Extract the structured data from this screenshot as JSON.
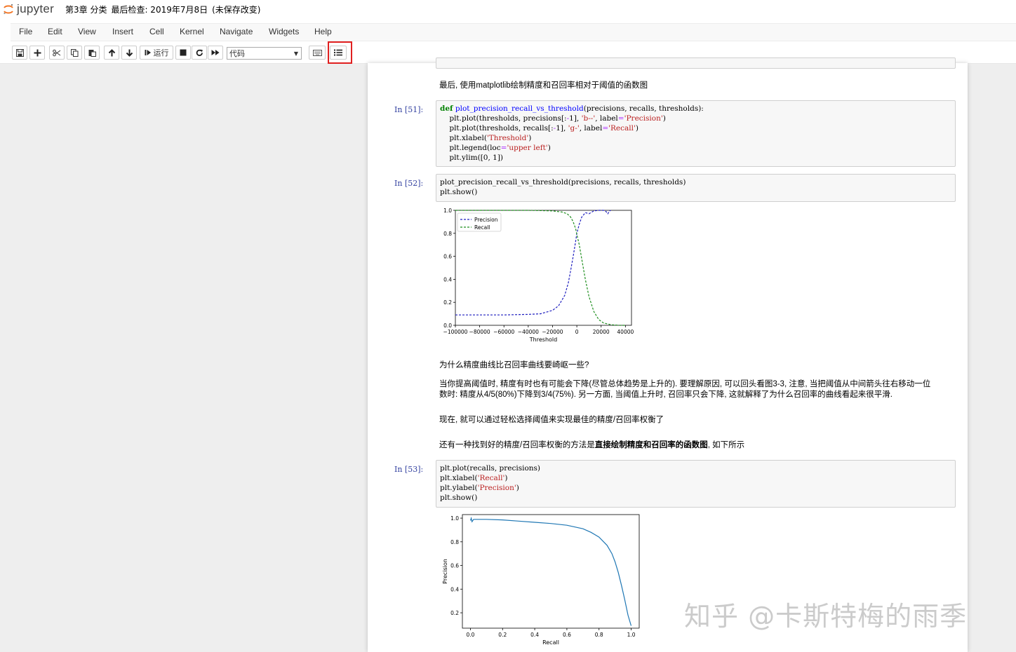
{
  "header": {
    "logo_text": "jupyter",
    "notebook_name": "第3章 分类",
    "checkpoint": "最后检查: 2019年7月8日",
    "save_status": "(未保存改变)"
  },
  "menu": [
    "File",
    "Edit",
    "View",
    "Insert",
    "Cell",
    "Kernel",
    "Navigate",
    "Widgets",
    "Help"
  ],
  "toolbar": {
    "run_label": "运行",
    "cell_type": "代码"
  },
  "cells": {
    "md_1": "最后, 使用matplotlib绘制精度和召回率相对于阈值的函数图",
    "c51_prompt": "In  [51]:",
    "c52_prompt": "In  [52]:",
    "c52_code": "plot_precision_recall_vs_threshold(precisions, recalls, thresholds)\nplt.show()",
    "md_2": "为什么精度曲线比召回率曲线要崎岖一些?",
    "md_3a": "当你提高阈值时, 精度有时也有可能会下降(尽管总体趋势是上升的). 要理解原因, 可以回头看图3-3, 注意, 当把阈值从中间箭头往右移动一位",
    "md_3b": "数时: 精度从4/5(80%)下降到3/4(75%). 另一方面, 当阈值上升时, 召回率只会下降, 这就解释了为什么召回率的曲线看起来很平滑.",
    "md_4": "现在, 就可以通过轻松选择阈值来实现最佳的精度/召回率权衡了",
    "md_5_pre": "还有一种找到好的精度/召回率权衡的方法是",
    "md_5_bold": "直接绘制精度和召回率的函数图",
    "md_5_post": ", 如下所示",
    "c53_prompt": "In  [53]:"
  },
  "chart_data": [
    {
      "type": "line",
      "xlabel": "Threshold",
      "ylabel": "",
      "xlim": [
        -100000,
        45000
      ],
      "ylim": [
        0,
        1
      ],
      "xticks": [
        "−100000",
        "−80000",
        "−60000",
        "−40000",
        "−20000",
        "0",
        "20000",
        "40000"
      ],
      "yticks": [
        "0.0",
        "0.2",
        "0.4",
        "0.6",
        "0.8",
        "1.0"
      ],
      "legend": "upper-left",
      "series": [
        {
          "name": "Precision",
          "color": "#1f1fbf",
          "dash": true,
          "x": [
            -100000,
            -80000,
            -60000,
            -40000,
            -30000,
            -20000,
            -15000,
            -10000,
            -7000,
            -5000,
            -3000,
            -1000,
            0,
            2000,
            4000,
            7000,
            10000,
            14000,
            18000,
            22000,
            24000,
            25500,
            27000,
            28000
          ],
          "y": [
            0.09,
            0.09,
            0.09,
            0.095,
            0.1,
            0.13,
            0.17,
            0.26,
            0.37,
            0.48,
            0.6,
            0.73,
            0.8,
            0.88,
            0.94,
            0.98,
            0.97,
            0.995,
            1.0,
            1.0,
            0.99,
            0.97,
            0.995,
            1.0
          ]
        },
        {
          "name": "Recall",
          "color": "#1f8f1f",
          "dash": true,
          "x": [
            -100000,
            -40000,
            -20000,
            -12000,
            -8000,
            -5000,
            -3000,
            -1000,
            0,
            2000,
            4000,
            7000,
            10000,
            14000,
            18000,
            22000,
            28000,
            35000,
            40000
          ],
          "y": [
            1.0,
            1.0,
            0.995,
            0.985,
            0.97,
            0.94,
            0.9,
            0.84,
            0.79,
            0.7,
            0.58,
            0.4,
            0.25,
            0.12,
            0.05,
            0.02,
            0.005,
            0.0,
            0.0
          ]
        }
      ]
    },
    {
      "type": "line",
      "xlabel": "Recall",
      "ylabel": "Precision",
      "xlim": [
        -0.05,
        1.05
      ],
      "ylim": [
        0.07,
        1.03
      ],
      "xticks": [
        "0.0",
        "0.2",
        "0.4",
        "0.6",
        "0.8",
        "1.0"
      ],
      "yticks": [
        "0.2",
        "0.4",
        "0.6",
        "0.8",
        "1.0"
      ],
      "series": [
        {
          "color": "#1f77b4",
          "x": [
            0.0,
            0.005,
            0.01,
            0.02,
            0.05,
            0.1,
            0.2,
            0.3,
            0.4,
            0.5,
            0.6,
            0.7,
            0.75,
            0.8,
            0.85,
            0.88,
            0.9,
            0.92,
            0.94,
            0.96,
            0.98,
            1.0
          ],
          "y": [
            0.98,
            1.0,
            0.97,
            0.99,
            0.99,
            0.99,
            0.985,
            0.975,
            0.965,
            0.955,
            0.94,
            0.91,
            0.88,
            0.84,
            0.77,
            0.7,
            0.63,
            0.54,
            0.43,
            0.31,
            0.18,
            0.09
          ]
        }
      ]
    }
  ],
  "watermark": "知乎 @卡斯特梅的雨季"
}
